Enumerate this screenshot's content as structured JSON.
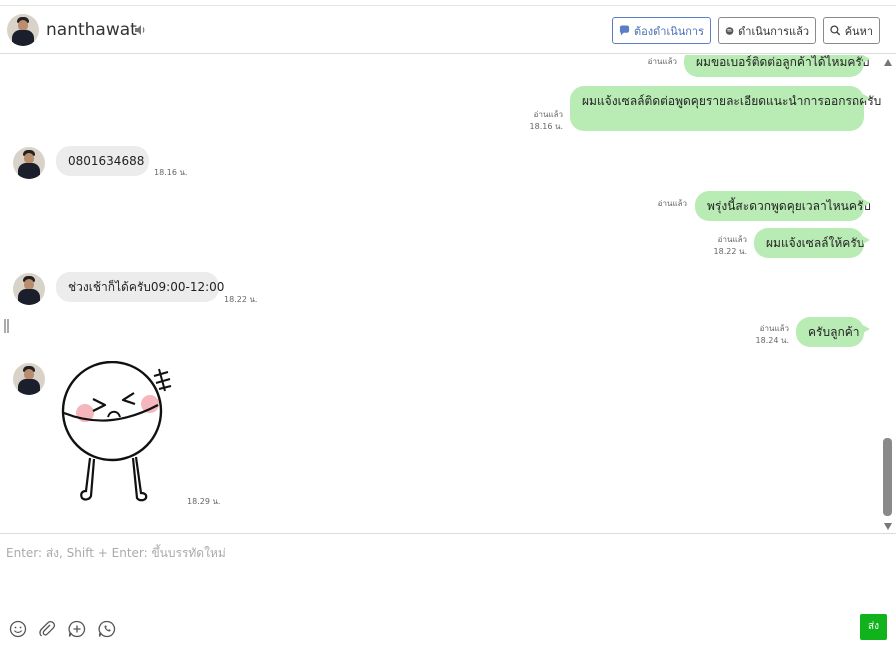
{
  "header": {
    "username": "nanthawat",
    "buttons": {
      "todo": "ต้องดำเนินการ",
      "done": "ดำเนินการแล้ว",
      "search": "ค้นหา"
    }
  },
  "messages": {
    "m1": {
      "text": "ผมขอเบอร์ติดต่อลูกค้าได้ไหมครับ",
      "status": "อ่านแล้ว"
    },
    "m2": {
      "text": "ผมแจ้งเซลล์ติดต่อพูดคุยรายละเอียดแนะนำการออกรถครับ",
      "status": "อ่านแล้ว",
      "time": "18.16 น."
    },
    "m3": {
      "text": "0801634688",
      "time": "18.16 น."
    },
    "m4": {
      "text": "พรุ่งนี้สะดวกพูดคุยเวลาไหนครับ",
      "status": "อ่านแล้ว"
    },
    "m5": {
      "text": "ผมแจ้งเซลล์ให้ครับ",
      "status": "อ่านแล้ว",
      "time": "18.22 น."
    },
    "m6": {
      "text": "ช่วงเช้าก็ได้ครับ09:00-12:00",
      "time": "18.22 น."
    },
    "m7": {
      "text": "ครับลูกค้า",
      "status": "อ่านแล้ว",
      "time": "18.24 น."
    },
    "m8": {
      "time": "18.29 น."
    }
  },
  "composer": {
    "placeholder": "Enter: ส่ง, Shift + Enter: ขึ้นบรรทัดใหม่",
    "send_label": "ส่ง"
  },
  "icons": [
    "speaker-icon",
    "chat-bubble-icon",
    "search-icon",
    "emoji-icon",
    "paperclip-icon",
    "add-circle-icon",
    "whatsapp-icon"
  ],
  "colors": {
    "outgoing_bubble": "#b9ebb4",
    "incoming_bubble": "#ececec",
    "send_button": "#10b31b",
    "active_button": "#4a6fb5"
  }
}
